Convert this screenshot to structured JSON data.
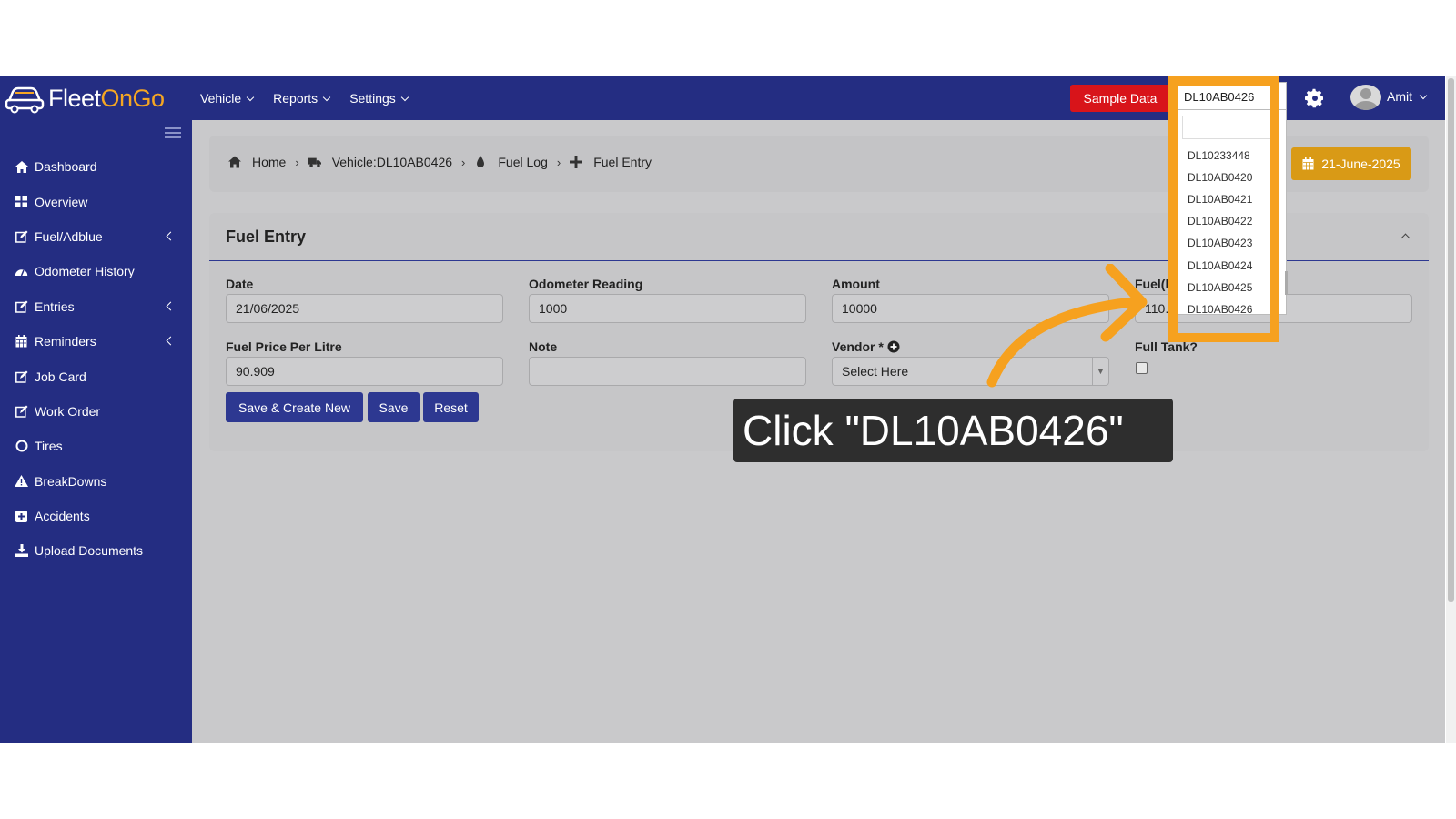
{
  "brand": {
    "logo_text_white": "Fleet",
    "logo_text_orange": "OnGo"
  },
  "topnav": {
    "items": [
      {
        "label": "Vehicle"
      },
      {
        "label": "Reports"
      },
      {
        "label": "Settings"
      }
    ],
    "sample_data_label": "Sample Data",
    "vehicle_selected": "DL10AB0426",
    "user_name": "Amit"
  },
  "sidebar": {
    "items": [
      {
        "label": "Dashboard",
        "icon": "home-icon",
        "has_arrow": false
      },
      {
        "label": "Overview",
        "icon": "grid-icon",
        "has_arrow": false
      },
      {
        "label": "Fuel/Adblue",
        "icon": "edit-icon",
        "has_arrow": true
      },
      {
        "label": "Odometer History",
        "icon": "gauge-icon",
        "has_arrow": false
      },
      {
        "label": "Entries",
        "icon": "edit-icon",
        "has_arrow": true
      },
      {
        "label": "Reminders",
        "icon": "calendar-icon",
        "has_arrow": true
      },
      {
        "label": "Job Card",
        "icon": "edit-icon",
        "has_arrow": false
      },
      {
        "label": "Work Order",
        "icon": "edit-icon",
        "has_arrow": false
      },
      {
        "label": "Tires",
        "icon": "circle-icon",
        "has_arrow": false
      },
      {
        "label": "BreakDowns",
        "icon": "warning-icon",
        "has_arrow": false
      },
      {
        "label": "Accidents",
        "icon": "plus-square-icon",
        "has_arrow": false
      },
      {
        "label": "Upload Documents",
        "icon": "download-icon",
        "has_arrow": false
      }
    ]
  },
  "breadcrumb": {
    "home": "Home",
    "vehicle": "Vehicle:DL10AB0426",
    "fuel_log": "Fuel Log",
    "current": "Fuel Entry"
  },
  "date_button": "21-June-2025",
  "form": {
    "title": "Fuel Entry",
    "date_label": "Date",
    "date_value": "21/06/2025",
    "odometer_label": "Odometer Reading",
    "odometer_value": "1000",
    "amount_label": "Amount",
    "amount_value": "10000",
    "fuel_label": "Fuel(l",
    "fuel_value": "110.0",
    "price_label": "Fuel Price Per Litre",
    "price_value": "90.909",
    "note_label": "Note",
    "note_value": "",
    "vendor_label": "Vendor *",
    "vendor_placeholder": "Select Here",
    "fulltank_label": "Full Tank?",
    "save_create_label": "Save & Create New",
    "save_label": "Save",
    "reset_label": "Reset"
  },
  "dropdown": {
    "options": [
      "DL10233448",
      "DL10AB0420",
      "DL10AB0421",
      "DL10AB0422",
      "DL10AB0423",
      "DL10AB0424",
      "DL10AB0425",
      "DL10AB0426"
    ]
  },
  "callout": {
    "text": "Click \"DL10AB0426\""
  },
  "colors": {
    "navy": "#242d82",
    "accent_orange": "#f6a11f",
    "red": "#d8141a",
    "gold": "#d99a16"
  }
}
